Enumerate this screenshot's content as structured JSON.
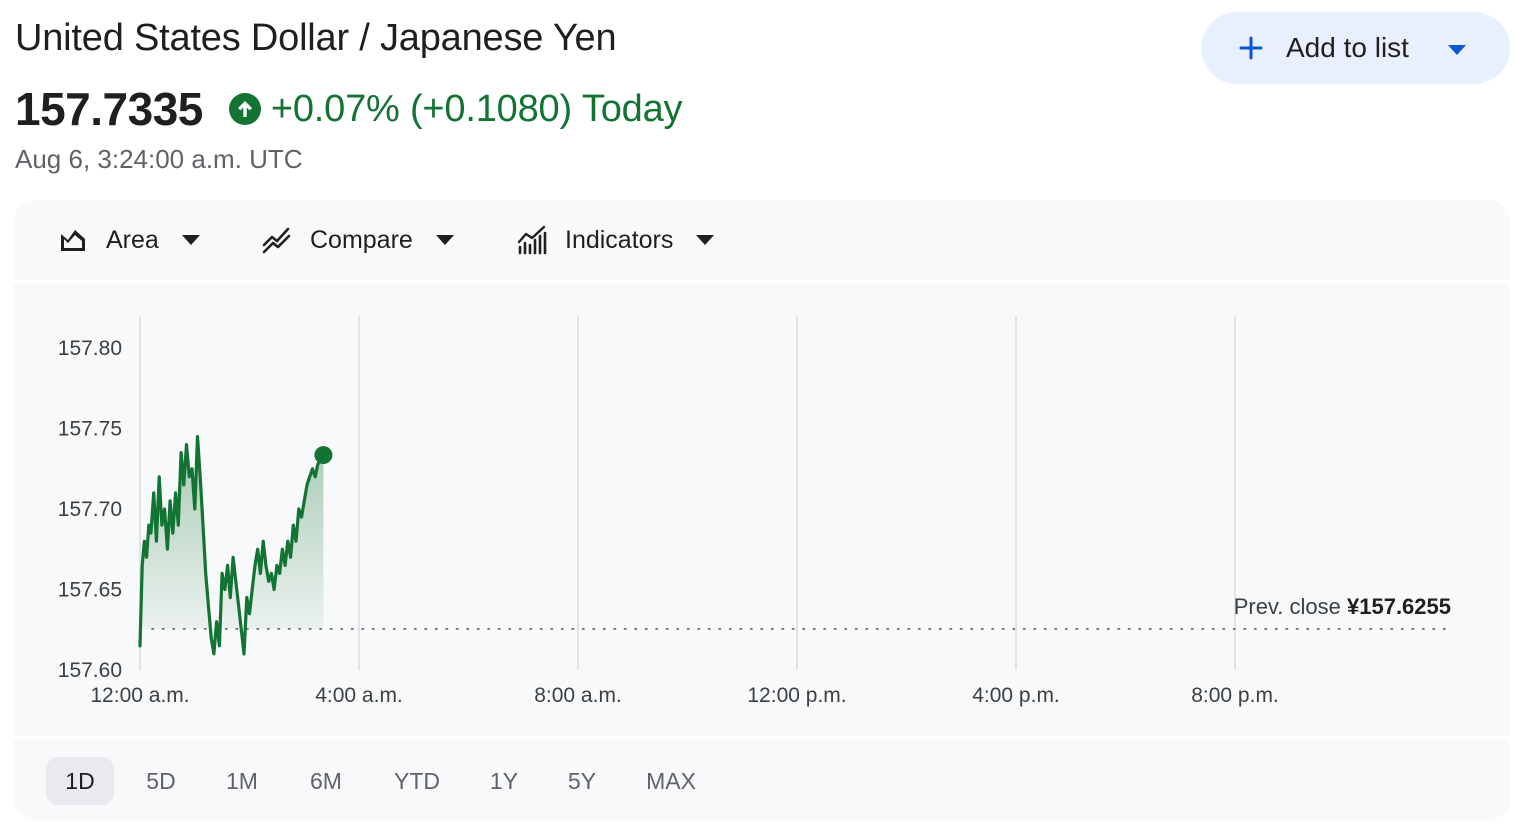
{
  "header": {
    "title": "United States Dollar / Japanese Yen",
    "price": "157.7335",
    "change": "+0.07% (+0.1080)",
    "change_period": "Today",
    "timestamp": "Aug 6, 3:24:00 a.m. UTC",
    "up_icon": "arrow-up-circle-icon",
    "positive_color": "#137333"
  },
  "add_to_list": {
    "label": "Add to list",
    "icon": "plus-icon",
    "accent": "#0b57d0"
  },
  "toolbar": {
    "area_label": "Area",
    "compare_label": "Compare",
    "indicators_label": "Indicators"
  },
  "ranges": {
    "items": [
      "1D",
      "5D",
      "1M",
      "6M",
      "YTD",
      "1Y",
      "5Y",
      "MAX"
    ],
    "active": "1D"
  },
  "chart_data": {
    "type": "area",
    "x_unit": "hours after 12:00 a.m. UTC",
    "xlim": [
      0,
      24
    ],
    "ylim": [
      157.6,
      157.8
    ],
    "y_ticks": [
      "157.80",
      "157.75",
      "157.70",
      "157.65",
      "157.60"
    ],
    "y_tick_values": [
      157.8,
      157.75,
      157.7,
      157.65,
      157.6
    ],
    "x_ticks": [
      "12:00 a.m.",
      "4:00 a.m.",
      "8:00 a.m.",
      "12:00 p.m.",
      "4:00 p.m.",
      "8:00 p.m."
    ],
    "x_tick_values": [
      0,
      4,
      8,
      12,
      16,
      20
    ],
    "grid": "vertical",
    "line_color": "#137333",
    "prev_close_label": "Prev. close",
    "prev_close_value": "¥157.6255",
    "prev_close": 157.6255,
    "series": [
      {
        "x": [
          0.0,
          0.04,
          0.08,
          0.12,
          0.16,
          0.2,
          0.25,
          0.3,
          0.35,
          0.4,
          0.45,
          0.5,
          0.55,
          0.6,
          0.65,
          0.7,
          0.75,
          0.8,
          0.85,
          0.9,
          0.95,
          1.0,
          1.05,
          1.1,
          1.15,
          1.2,
          1.25,
          1.3,
          1.35,
          1.4,
          1.45,
          1.5,
          1.55,
          1.6,
          1.65,
          1.7,
          1.75,
          1.8,
          1.85,
          1.9,
          1.95,
          2.0,
          2.05,
          2.1,
          2.15,
          2.2,
          2.25,
          2.3,
          2.35,
          2.4,
          2.45,
          2.5,
          2.55,
          2.6,
          2.65,
          2.7,
          2.75,
          2.8,
          2.85,
          2.9,
          2.95,
          3.0,
          3.05,
          3.1,
          3.15,
          3.2,
          3.25,
          3.3,
          3.35
        ],
        "values": [
          157.615,
          157.665,
          157.68,
          157.67,
          157.69,
          157.685,
          157.71,
          157.68,
          157.72,
          157.69,
          157.7,
          157.675,
          157.705,
          157.685,
          157.71,
          157.69,
          157.735,
          157.715,
          157.74,
          157.72,
          157.725,
          157.7,
          157.745,
          157.72,
          157.69,
          157.66,
          157.64,
          157.62,
          157.61,
          157.63,
          157.615,
          157.66,
          157.65,
          157.665,
          157.645,
          157.67,
          157.655,
          157.64,
          157.625,
          157.61,
          157.645,
          157.635,
          157.65,
          157.665,
          157.675,
          157.66,
          157.68,
          157.665,
          157.655,
          157.66,
          157.65,
          157.665,
          157.66,
          157.675,
          157.665,
          157.68,
          157.67,
          157.69,
          157.68,
          157.7,
          157.695,
          157.705,
          157.715,
          157.72,
          157.725,
          157.72,
          157.728,
          157.73,
          157.7335
        ]
      }
    ]
  }
}
